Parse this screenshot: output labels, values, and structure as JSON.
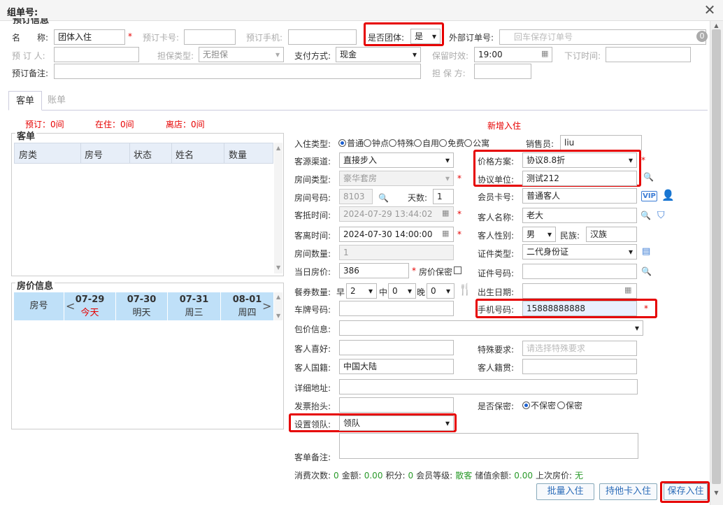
{
  "window": {
    "title": "组单号:"
  },
  "top": {
    "section_partial": "预订信息",
    "name_label": "名　　称:",
    "name_value": "团体入住",
    "card_label": "预订卡号:",
    "phone_label": "预订手机:",
    "group_label": "是否团体:",
    "group_value": "是",
    "ext_order_label": "外部订单号:",
    "ext_order_placeholder": "回车保存订单号",
    "ext_order_badge": "0",
    "booker_label": "预 订 人:",
    "guarantee_type_label": "担保类型:",
    "guarantee_type_value": "无担保",
    "pay_label": "支付方式:",
    "pay_value": "现金",
    "hold_label": "保留时效:",
    "hold_value": "19:00",
    "order_time_label": "下订时间:",
    "remark_label": "预订备注:",
    "guarantor_label": "担 保 方:"
  },
  "tabs": [
    {
      "label": "客单"
    },
    {
      "label": "账单"
    }
  ],
  "status": {
    "booked": "预订：0间",
    "staying": "在住：0间",
    "leaving": "离店：0间",
    "new_checkin": "新增入住"
  },
  "room_list": {
    "title": "客单",
    "columns": [
      "房类",
      "房号",
      "状态",
      "姓名",
      "数量"
    ]
  },
  "price_info": {
    "title": "房价信息",
    "room_label": "房号",
    "days": [
      {
        "date": "07-29",
        "label": "今天"
      },
      {
        "date": "07-30",
        "label": "明天"
      },
      {
        "date": "07-31",
        "label": "周三"
      },
      {
        "date": "08-01",
        "label": "周四"
      }
    ]
  },
  "form": {
    "checkin_type_label": "入住类型:",
    "checkin_types": [
      "普通",
      "钟点",
      "特殊",
      "自用",
      "免费",
      "公寓"
    ],
    "salesperson_label": "销售员:",
    "salesperson_value": "liu",
    "source_label": "客源渠道:",
    "source_value": "直接步入",
    "plan_label": "价格方案:",
    "plan_value": "协议8.8折",
    "room_type_label": "房间类型:",
    "room_type_value": "豪华套房",
    "agreement_label": "协议单位:",
    "agreement_value": "测试212",
    "room_no_label": "房间号码:",
    "room_no_value": "8103",
    "days_label": "天数:",
    "days_value": "1",
    "member_label": "会员卡号:",
    "member_value": "普通客人",
    "vip_text": "VIP",
    "arrive_label": "客抵时间:",
    "arrive_value": "2024-07-29 13:44:02",
    "guest_name_label": "客人名称:",
    "guest_name_value": "老大",
    "depart_label": "客离时间:",
    "depart_value": "2024-07-30 14:00:00",
    "gender_label": "客人性别:",
    "gender_value": "男",
    "ethnicity_label": "民族:",
    "ethnicity_value": "汉族",
    "room_count_label": "房间数量:",
    "room_count_value": "1",
    "id_type_label": "证件类型:",
    "id_type_value": "二代身份证",
    "day_price_label": "当日房价:",
    "day_price_value": "386",
    "price_secret_label": "房价保密",
    "id_no_label": "证件号码:",
    "meal_label": "餐券数量:",
    "meal_b_label": "早",
    "meal_b_value": "2",
    "meal_l_label": "中",
    "meal_l_value": "0",
    "meal_d_label": "晚",
    "meal_d_value": "0",
    "birth_label": "出生日期:",
    "plate_label": "车牌号码:",
    "mobile_label": "手机号码:",
    "mobile_value": "15888888888",
    "package_label": "包价信息:",
    "hobby_label": "客人喜好:",
    "special_label": "特殊要求:",
    "special_placeholder": "请选择特殊要求",
    "nationality_label": "客人国籍:",
    "nationality_value": "中国大陆",
    "native_label": "客人籍贯:",
    "address_label": "详细地址:",
    "invoice_label": "发票抬头:",
    "secret_label": "是否保密:",
    "secret_opt1": "不保密",
    "secret_opt2": "保密",
    "leader_label": "设置领队:",
    "leader_value": "领队",
    "remark_label": "客单备注:"
  },
  "footer_stats": {
    "consume_label": "消费次数:",
    "consume_value": "0",
    "amount_label": "金额:",
    "amount_value": "0.00",
    "points_label": "积分:",
    "points_value": "0",
    "level_label": "会员等级:",
    "level_value": "散客",
    "balance_label": "储值余额:",
    "balance_value": "0.00",
    "last_price_label": "上次房价:",
    "last_price_value": "无"
  },
  "buttons": {
    "batch": "批量入住",
    "other_card": "持他卡入住",
    "save": "保存入住"
  },
  "colors": {
    "required": "#e60000",
    "highlight": "#e60000",
    "grid_header": "#e7eef8",
    "price_row": "#bfe0f8"
  }
}
